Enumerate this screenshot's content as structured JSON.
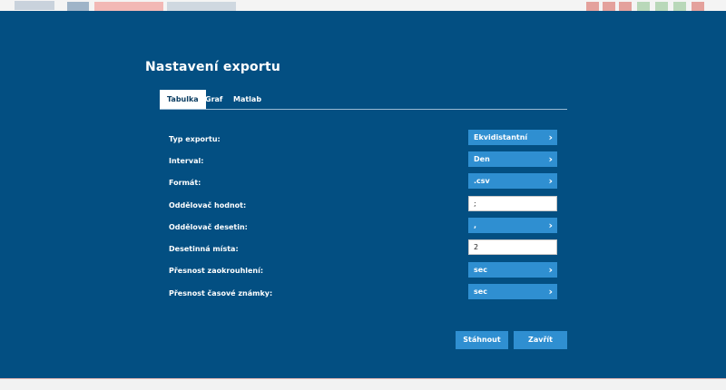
{
  "modal": {
    "title": "Nastavení exportu",
    "accent_color": "#2f8fd1",
    "background_color": "#034f82"
  },
  "tabs": [
    {
      "label": "Tabulka",
      "active": true
    },
    {
      "label": "Graf",
      "active": false
    },
    {
      "label": "Matlab",
      "active": false
    }
  ],
  "fields": [
    {
      "label": "Typ exportu:",
      "type": "select",
      "value": "Ekvidistantní",
      "icon": "chevron-right-icon"
    },
    {
      "label": "Interval:",
      "type": "select",
      "value": "Den",
      "icon": "chevron-right-icon"
    },
    {
      "label": "Formát:",
      "type": "select",
      "value": ".csv",
      "icon": "chevron-right-icon"
    },
    {
      "label": "Oddělovač hodnot:",
      "type": "input",
      "value": ";"
    },
    {
      "label": "Oddělovač desetin:",
      "type": "select",
      "value": ",",
      "icon": "chevron-right-icon"
    },
    {
      "label": "Desetinná místa:",
      "type": "input",
      "value": "2"
    },
    {
      "label": "Přesnost zaokrouhlení:",
      "type": "select",
      "value": "sec",
      "icon": "chevron-right-icon"
    },
    {
      "label": "Přesnost časové známky:",
      "type": "select",
      "value": "sec",
      "icon": "chevron-right-icon"
    }
  ],
  "buttons": {
    "download_label": "Stáhnout",
    "close_label": "Zavřít"
  }
}
